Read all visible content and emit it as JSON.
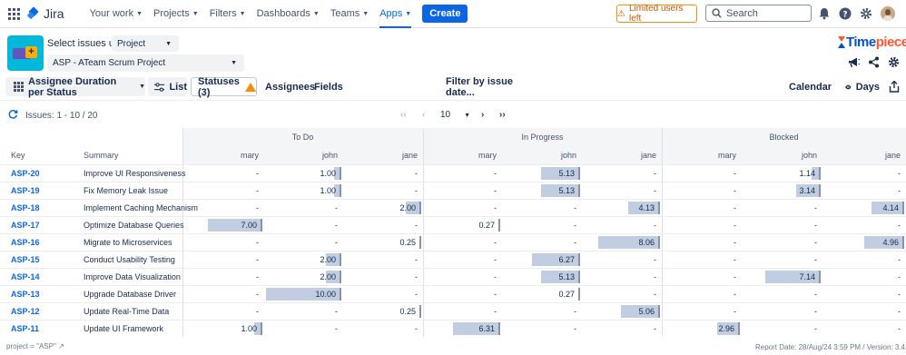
{
  "nav": {
    "app_name": "Jira",
    "items": [
      {
        "label": "Your work",
        "active": false
      },
      {
        "label": "Projects",
        "active": false
      },
      {
        "label": "Filters",
        "active": false
      },
      {
        "label": "Dashboards",
        "active": false
      },
      {
        "label": "Teams",
        "active": false
      },
      {
        "label": "Apps",
        "active": true
      }
    ],
    "create_label": "Create",
    "limited_users_label": "Limited users left",
    "search_placeholder": "Search"
  },
  "header": {
    "select_using_label": "Select issues using",
    "select_using_value": "Project",
    "project_value": "ASP - ATeam Scrum Project",
    "brand_time": "Time",
    "brand_piece": "piece"
  },
  "toolbar": {
    "report_label": "Assignee Duration per Status",
    "list_label": "List",
    "statuses_label": "Statuses (3)",
    "assignees_label": "Assignees",
    "fields_label": "Fields",
    "filter_label": "Filter by issue date...",
    "calendar_label": "Calendar",
    "days_label": "Days"
  },
  "pagination": {
    "issues_label": "Issues: 1 - 10 / 20",
    "first": "‹‹",
    "prev": "‹",
    "page_size": "10",
    "next": "›",
    "last": "››"
  },
  "table": {
    "key_header": "Key",
    "summary_header": "Summary",
    "groups": [
      "To Do",
      "In Progress",
      "Blocked"
    ],
    "assignees": [
      "mary",
      "john",
      "jane"
    ],
    "max_value": 10.0,
    "rows": [
      {
        "key": "ASP-20",
        "summary": "Improve UI Responsiveness",
        "values": [
          "-",
          "1.00",
          "-",
          "-",
          "5.13",
          "-",
          "-",
          "1.14",
          "-"
        ]
      },
      {
        "key": "ASP-19",
        "summary": "Fix Memory Leak Issue",
        "values": [
          "-",
          "1.00",
          "-",
          "-",
          "5.13",
          "-",
          "-",
          "3.14",
          "-"
        ]
      },
      {
        "key": "ASP-18",
        "summary": "Implement Caching Mechanism",
        "values": [
          "-",
          "-",
          "2.00",
          "-",
          "-",
          "4.13",
          "-",
          "-",
          "4.14"
        ]
      },
      {
        "key": "ASP-17",
        "summary": "Optimize Database Queries",
        "values": [
          "7.00",
          "-",
          "-",
          "0.27",
          "-",
          "-",
          "-",
          "-",
          "-"
        ]
      },
      {
        "key": "ASP-16",
        "summary": "Migrate to Microservices",
        "values": [
          "-",
          "-",
          "0.25",
          "-",
          "-",
          "8.06",
          "-",
          "-",
          "4.96"
        ]
      },
      {
        "key": "ASP-15",
        "summary": "Conduct Usability Testing",
        "values": [
          "-",
          "2.00",
          "-",
          "-",
          "6.27",
          "-",
          "-",
          "-",
          "-"
        ]
      },
      {
        "key": "ASP-14",
        "summary": "Improve Data Visualization",
        "values": [
          "-",
          "2.00",
          "-",
          "-",
          "5.13",
          "-",
          "-",
          "7.14",
          "-"
        ]
      },
      {
        "key": "ASP-13",
        "summary": "Upgrade Database Driver",
        "values": [
          "-",
          "10.00",
          "-",
          "-",
          "0.27",
          "-",
          "-",
          "-",
          "-"
        ]
      },
      {
        "key": "ASP-12",
        "summary": "Update Real-Time Data",
        "values": [
          "-",
          "-",
          "0.25",
          "-",
          "-",
          "5.06",
          "-",
          "-",
          "-"
        ]
      },
      {
        "key": "ASP-11",
        "summary": "Update UI Framework",
        "values": [
          "1.00",
          "-",
          "-",
          "6.31",
          "-",
          "-",
          "2.96",
          "-",
          "-"
        ]
      }
    ]
  },
  "footer": {
    "jql": "project = \"ASP\"",
    "report_info": "Report Date: 28/Aug/24 3:59 PM / Version: 3.4.0.878"
  },
  "colors": {
    "accent": "#0c66e4",
    "bar": "#c1cde0",
    "warning": "#ff8b00"
  }
}
